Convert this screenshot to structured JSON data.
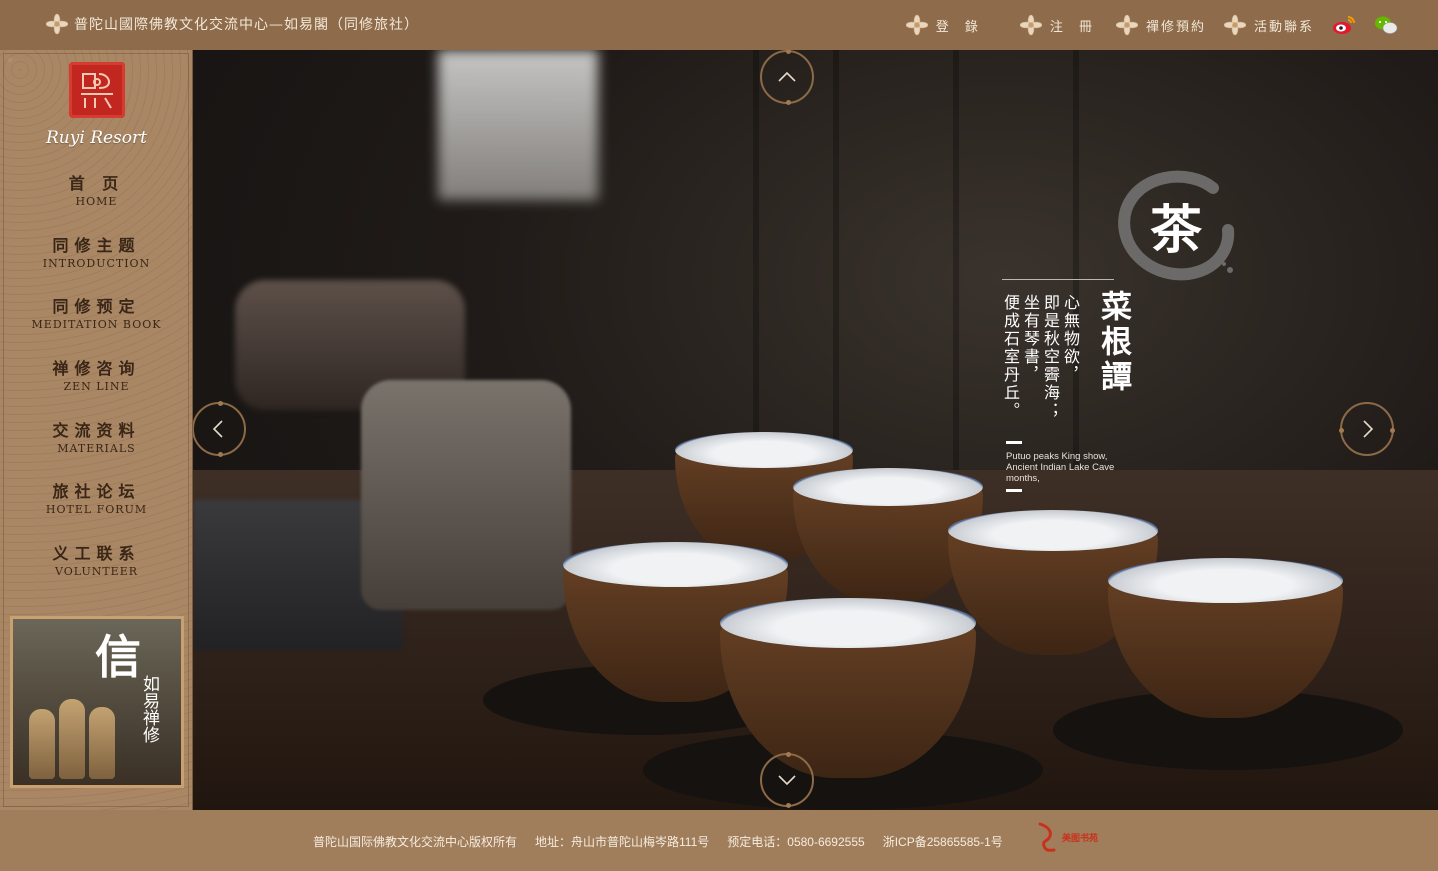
{
  "header": {
    "site_title": "普陀山國際佛教文化交流中心—如易閣（同修旅社）",
    "nav": [
      {
        "label": "登 錄",
        "icon": "lotus-icon"
      },
      {
        "label": "注 冊",
        "icon": "lotus-icon"
      },
      {
        "label": "禪修預約",
        "icon": "lotus-icon"
      },
      {
        "label": "活動聯系",
        "icon": "lotus-icon"
      }
    ],
    "social": [
      "weibo-icon",
      "wechat-icon"
    ]
  },
  "sidebar": {
    "logo_text": "Ruyi Resort",
    "items": [
      {
        "cn": "首 页",
        "en": "HOME"
      },
      {
        "cn": "同修主题",
        "en": "INTRODUCTION"
      },
      {
        "cn": "同修预定",
        "en": "MEDITATION BOOK"
      },
      {
        "cn": "禅修咨询",
        "en": "ZEN LINE"
      },
      {
        "cn": "交流资料",
        "en": "MATERIALS"
      },
      {
        "cn": "旅社论坛",
        "en": "HOTEL FORUM"
      },
      {
        "cn": "义工联系",
        "en": "VOLUNTEER"
      }
    ],
    "banner": {
      "big": "信",
      "small": "如易禅修"
    }
  },
  "hero": {
    "tea_char": "茶",
    "book_title": "菜根譚",
    "poem_columns": [
      "心無物欲，",
      "即是秋空霽海；",
      "坐有琴書，",
      "便成石室丹丘。"
    ],
    "poem_en": "Putuo peaks King show, Ancient Indian Lake Cave months,"
  },
  "footer": {
    "copyright": "普陀山国际佛教文化交流中心版权所有",
    "address": "地址：舟山市普陀山梅岑路111号",
    "phone": "预定电话：0580-6692555",
    "icp": "浙ICP备25865585-1号",
    "logo_text": "美图书苑"
  },
  "colors": {
    "topbar": "#8d6b4b",
    "sidebar": "#a98765",
    "footer": "#a07e5c",
    "accent": "#c2271f"
  }
}
